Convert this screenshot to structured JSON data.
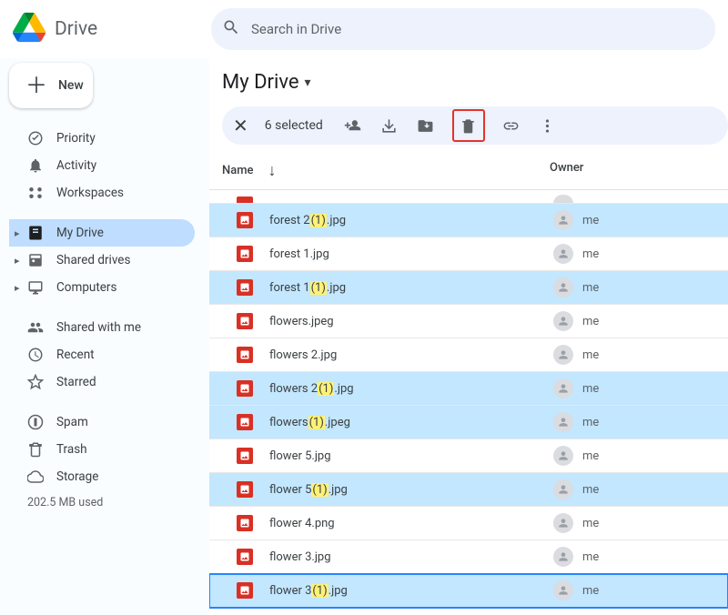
{
  "header": {
    "app_name": "Drive",
    "search_placeholder": "Search in Drive"
  },
  "new_button_label": "New",
  "sidebar": {
    "priority": "Priority",
    "activity": "Activity",
    "workspaces": "Workspaces",
    "my_drive": "My Drive",
    "shared_drives": "Shared drives",
    "computers": "Computers",
    "shared_with_me": "Shared with me",
    "recent": "Recent",
    "starred": "Starred",
    "spam": "Spam",
    "trash": "Trash",
    "storage": "Storage",
    "storage_used": "202.5 MB used"
  },
  "main": {
    "title": "My Drive",
    "selection_text": "6 selected",
    "columns": {
      "name": "Name",
      "owner": "Owner"
    },
    "files": [
      {
        "pre": "forest 2 ",
        "hl": "(1)",
        "post": ".jpg",
        "owner": "me",
        "selected": true
      },
      {
        "pre": "forest 1.jpg",
        "hl": "",
        "post": "",
        "owner": "me",
        "selected": false
      },
      {
        "pre": "forest 1 ",
        "hl": "(1)",
        "post": ".jpg",
        "owner": "me",
        "selected": true
      },
      {
        "pre": "flowers.jpeg",
        "hl": "",
        "post": "",
        "owner": "me",
        "selected": false
      },
      {
        "pre": "flowers 2.jpg",
        "hl": "",
        "post": "",
        "owner": "me",
        "selected": false
      },
      {
        "pre": "flowers 2 ",
        "hl": "(1)",
        "post": ".jpg",
        "owner": "me",
        "selected": true
      },
      {
        "pre": "flowers ",
        "hl": "(1)",
        "post": ".jpeg",
        "owner": "me",
        "selected": true
      },
      {
        "pre": "flower 5.jpg",
        "hl": "",
        "post": "",
        "owner": "me",
        "selected": false
      },
      {
        "pre": "flower 5 ",
        "hl": "(1)",
        "post": ".jpg",
        "owner": "me",
        "selected": true
      },
      {
        "pre": "flower 4.png",
        "hl": "",
        "post": "",
        "owner": "me",
        "selected": false
      },
      {
        "pre": "flower 3.jpg",
        "hl": "",
        "post": "",
        "owner": "me",
        "selected": false
      },
      {
        "pre": "flower 3 ",
        "hl": "(1)",
        "post": ".jpg",
        "owner": "me",
        "selected": true,
        "focused": true
      }
    ]
  }
}
